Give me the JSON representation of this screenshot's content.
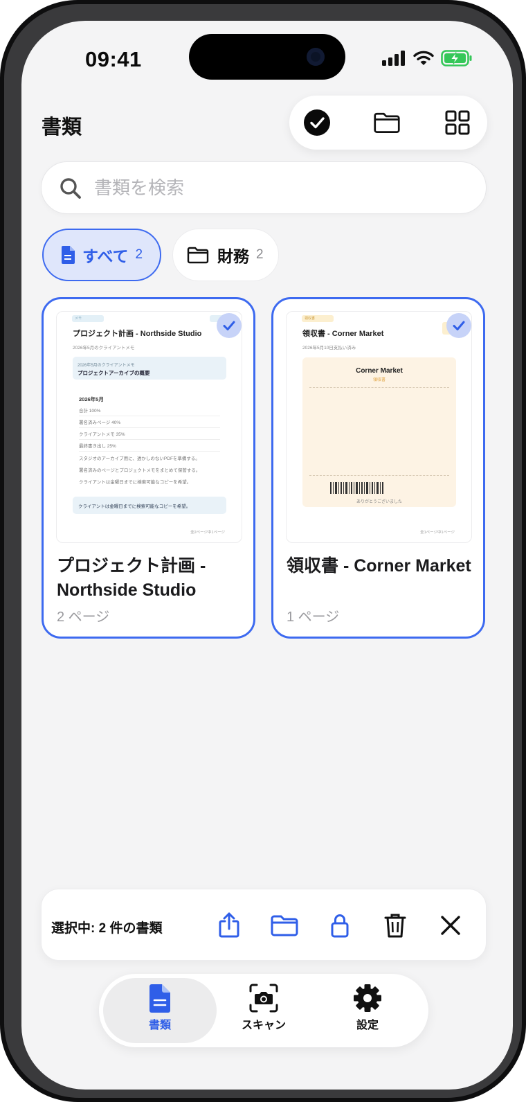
{
  "status": {
    "time": "09:41"
  },
  "header": {
    "title": "書類"
  },
  "search": {
    "placeholder": "書類を検索"
  },
  "filters": [
    {
      "label": "すべて",
      "count": "2"
    },
    {
      "label": "財務",
      "count": "2"
    }
  ],
  "documents": [
    {
      "name": "プロジェクト計画 - Northside Studio",
      "pages": "2 ページ",
      "thumb": {
        "tag": "メモ",
        "title": "プロジェクト計画 - Northside Studio",
        "subtitle": "2026年5月のクライアントメモ",
        "box_label": "2026年5月のクライアントメモ",
        "box_title": "プロジェクトアーカイブの概要",
        "heading": "2026年5月",
        "rows": [
          "合計 100%",
          "署名済みページ 40%",
          "クライアントメモ 35%",
          "最終書き出し 25%"
        ],
        "lines": [
          "スタジオのアーカイブ用に、透かしのないPDFを準備する。",
          "署名済みのページとプロジェクトメモをまとめて保管する。",
          "クライアントは金曜日までに検索可能なコピーを希望。"
        ],
        "note": "クライアントは金曜日までに検索可能なコピーを希望。",
        "footer": "全2ページ中1ページ"
      }
    },
    {
      "name": "領収書 - Corner Market",
      "pages": "1 ページ",
      "thumb": {
        "tag": "領収書",
        "title": "領収書 - Corner Market",
        "subtitle": "2026年5月10日支払い済み",
        "store": "Corner Market",
        "kind": "領収書",
        "thanks": "ありがとうございました",
        "footer": "全1ページ中1ページ"
      }
    }
  ],
  "selection": {
    "text": "選択中: 2 件の書類"
  },
  "tabs": [
    {
      "label": "書類",
      "active": true
    },
    {
      "label": "スキャン",
      "active": false
    },
    {
      "label": "設定",
      "active": false
    }
  ],
  "colors": {
    "accent": "#3d6af0",
    "accent_soft": "#dfe6fb",
    "background": "#f4f4f5",
    "battery": "#35c759"
  },
  "icons": {
    "top_actions": [
      "check-circle-icon",
      "folder-icon",
      "grid-icon"
    ],
    "selection_actions": [
      "share-icon",
      "folder-icon",
      "lock-icon",
      "trash-icon",
      "close-icon"
    ],
    "tabs": [
      "document-icon",
      "camera-scan-icon",
      "gear-icon"
    ]
  }
}
